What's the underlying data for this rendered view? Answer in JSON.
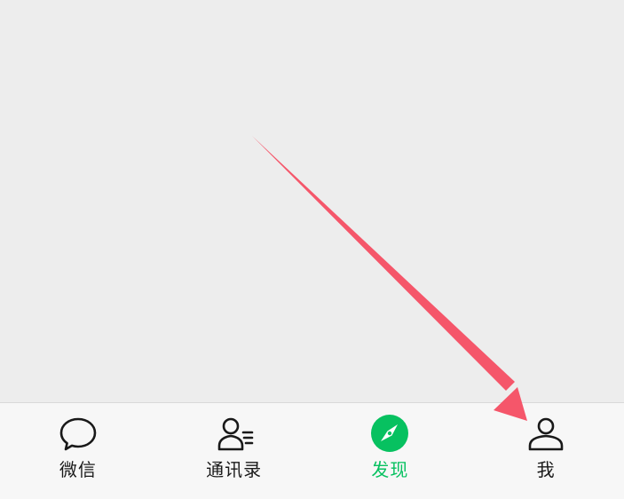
{
  "tabbar": {
    "tabs": [
      {
        "label": "微信",
        "icon": "chat-bubble-icon"
      },
      {
        "label": "通讯录",
        "icon": "contacts-icon"
      },
      {
        "label": "发现",
        "icon": "compass-icon"
      },
      {
        "label": "我",
        "icon": "person-icon"
      }
    ],
    "active_index": 2
  },
  "colors": {
    "active": "#07c160",
    "inactive": "#191919",
    "annotation_arrow": "#f5566a"
  }
}
